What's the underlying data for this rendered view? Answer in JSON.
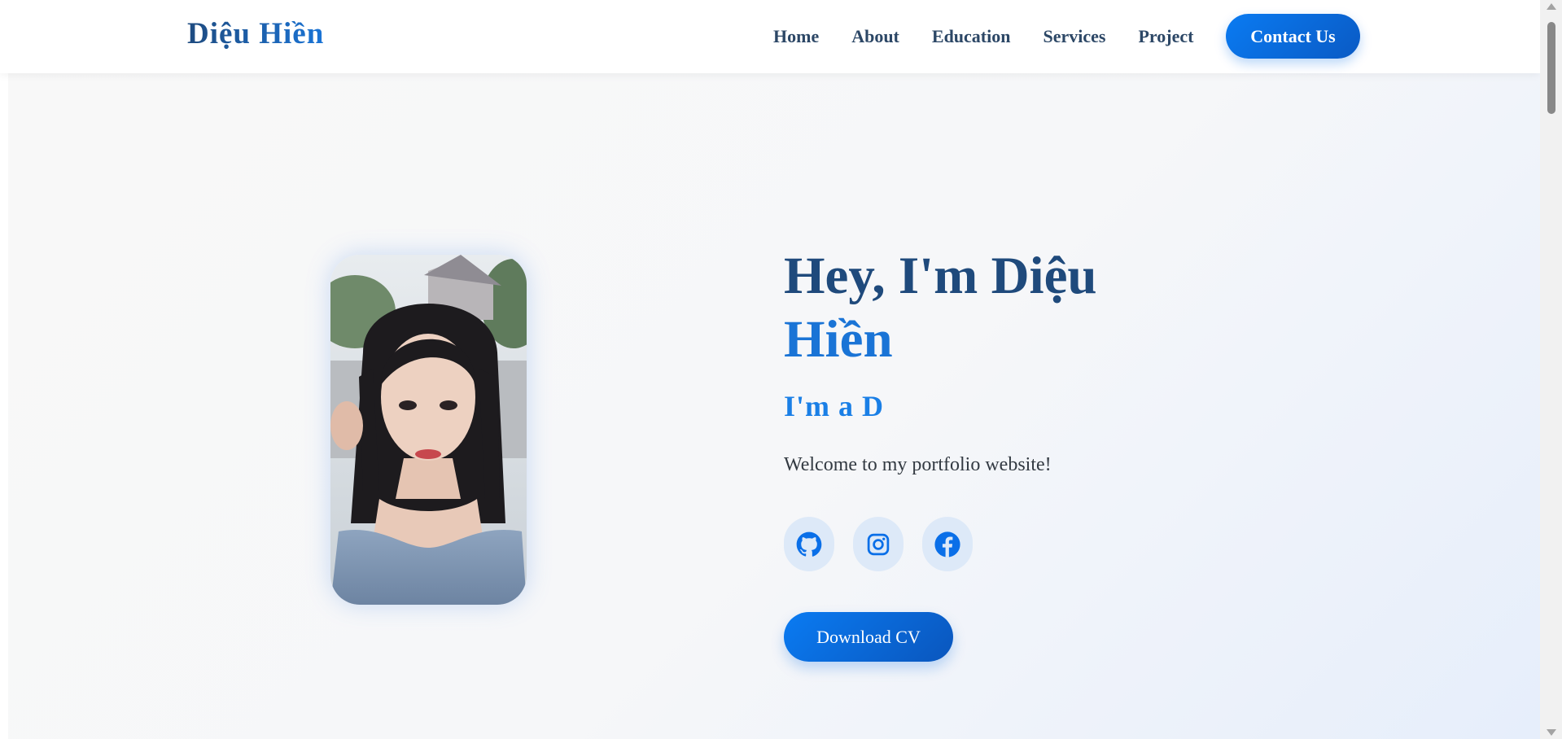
{
  "header": {
    "logo": "Diệu Hiền",
    "nav": [
      "Home",
      "About",
      "Education",
      "Services",
      "Project"
    ],
    "contact_label": "Contact Us"
  },
  "hero": {
    "greeting_line1": "Hey, I'm Diệu",
    "greeting_line2": "Hiền",
    "typed_text": "I'm a D",
    "welcome": "Welcome to my portfolio website!",
    "socials": [
      "github-icon",
      "instagram-icon",
      "facebook-icon"
    ],
    "download_label": "Download CV"
  },
  "colors": {
    "primary": "#0a6fe8",
    "navy": "#1f4a7c",
    "nav_text": "#2c4766",
    "icon_bg": "#dde9f8"
  }
}
